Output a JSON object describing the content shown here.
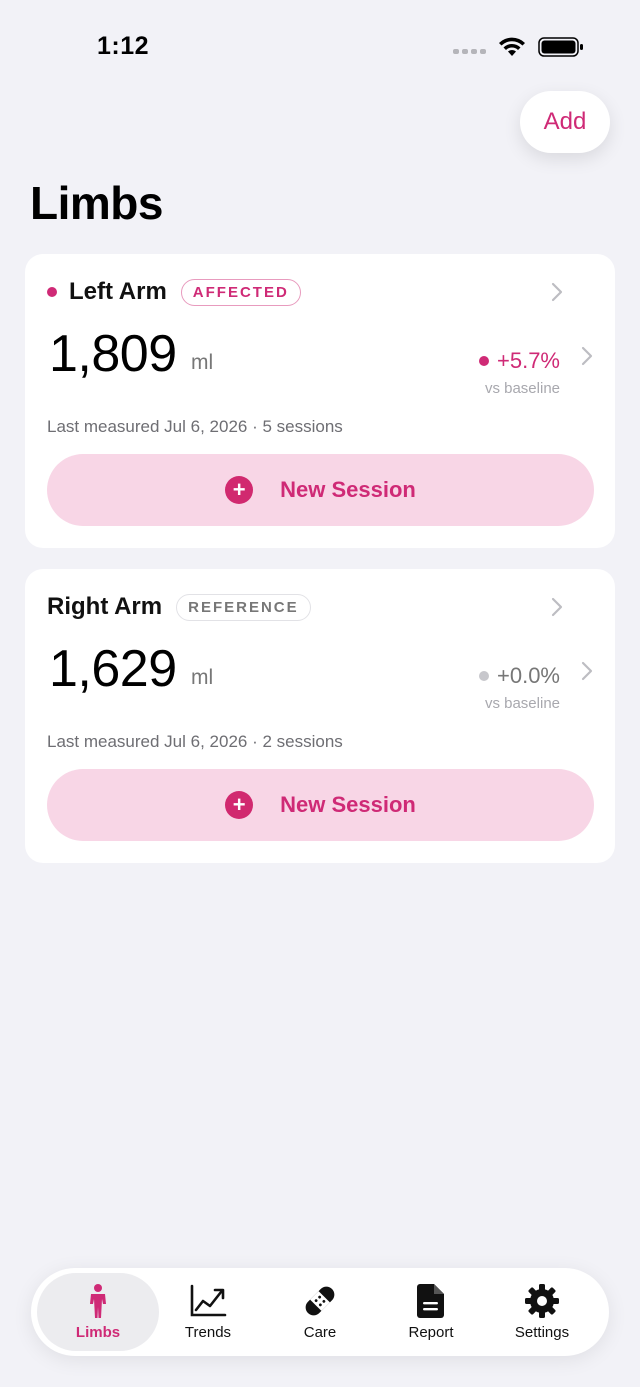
{
  "status_bar": {
    "time": "1:12"
  },
  "header": {
    "add_label": "Add",
    "title": "Limbs"
  },
  "limbs": [
    {
      "name": "Left Arm",
      "badge": "AFFECTED",
      "volume": "1,809",
      "unit": "ml",
      "delta": "+5.7%",
      "delta_caption": "vs baseline",
      "last_measured": "Last measured Jul 6, 2026 · 5 sessions",
      "new_session_label": "New Session"
    },
    {
      "name": "Right Arm",
      "badge": "REFERENCE",
      "volume": "1,629",
      "unit": "ml",
      "delta": "+0.0%",
      "delta_caption": "vs baseline",
      "last_measured": "Last measured Jul 6, 2026 · 2 sessions",
      "new_session_label": "New Session"
    }
  ],
  "tabs": [
    {
      "label": "Limbs",
      "icon": "person-icon",
      "active": true
    },
    {
      "label": "Trends",
      "icon": "trend-chart-icon",
      "active": false
    },
    {
      "label": "Care",
      "icon": "bandage-icon",
      "active": false
    },
    {
      "label": "Report",
      "icon": "document-icon",
      "active": false
    },
    {
      "label": "Settings",
      "icon": "gear-icon",
      "active": false
    }
  ],
  "colors": {
    "accent": "#CF2A76",
    "accent_soft": "#F8D6E6",
    "background": "#F2F2F7",
    "neutral_dot": "#C7C7CC"
  }
}
